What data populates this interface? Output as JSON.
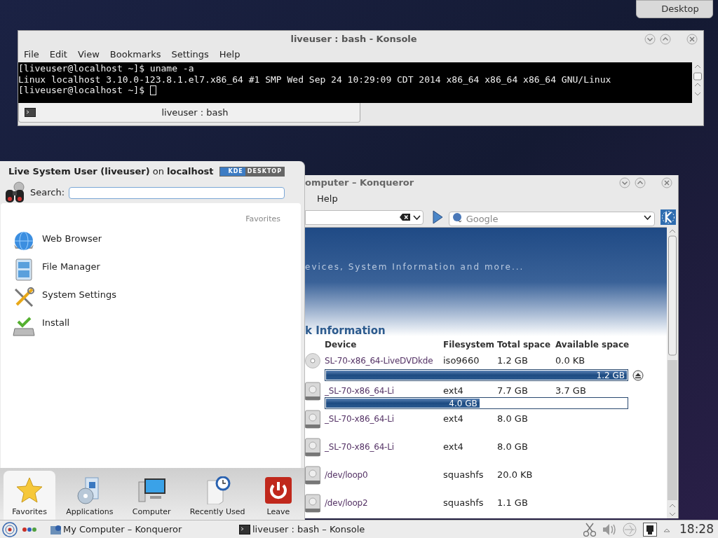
{
  "desktop_button": {
    "label": "Desktop"
  },
  "konsole": {
    "title": "liveuser : bash - Konsole",
    "menu": [
      "File",
      "Edit",
      "View",
      "Bookmarks",
      "Settings",
      "Help"
    ],
    "lines": [
      "[liveuser@localhost ~]$ uname -a",
      "Linux localhost 3.10.0-123.8.1.el7.x86_64 #1 SMP Wed Sep 24 10:29:09 CDT 2014 x86_64 x86_64 x86_64 GNU/Linux",
      "[liveuser@localhost ~]$ "
    ],
    "tabs": [
      {
        "label": "liveuser : bash",
        "selected": true
      }
    ]
  },
  "konqueror": {
    "title": "omputer – Konqueror",
    "menu": [
      "Help"
    ],
    "search": {
      "placeholder": "Google"
    },
    "banner": "evices, System Information and more...",
    "heading": "k Information",
    "columns": [
      "Device",
      "Filesystem",
      "Total space",
      "Available space"
    ],
    "rows": [
      {
        "kind": "optical",
        "device": "SL-70-x86_64-LiveDVDkde",
        "filesystem": "iso9660",
        "total": "1.2 GB",
        "available": "0.0 KB",
        "usage": {
          "level": 1,
          "label": "1.2 GB"
        }
      },
      {
        "kind": "disk",
        "device": "_SL-70-x86_64-Li",
        "filesystem": "ext4",
        "total": "7.7 GB",
        "available": "3.7 GB",
        "usage": {
          "level": 0.51,
          "label": "4.0 GB"
        }
      },
      {
        "kind": "disk",
        "device": "_SL-70-x86_64-Li",
        "filesystem": "ext4",
        "total": "8.0 GB"
      },
      {
        "kind": "disk",
        "device": "_SL-70-x86_64-Li",
        "filesystem": "ext4",
        "total": "8.0 GB"
      },
      {
        "kind": "disk",
        "device": "/dev/loop0",
        "filesystem": "squashfs",
        "total": "20.0 KB"
      },
      {
        "kind": "disk",
        "device": "/dev/loop2",
        "filesystem": "squashfs",
        "total": "1.1 GB"
      }
    ]
  },
  "launcher": {
    "user": "**Live System User (liveuser)** on **localhost**",
    "badge": [
      "KDE",
      "DESKTOP"
    ],
    "search_label": "Search:",
    "section": "Favorites",
    "favorites": [
      {
        "kind": "globe",
        "label": "Web Browser"
      },
      {
        "kind": "files",
        "label": "File Manager"
      },
      {
        "kind": "tools",
        "label": "System Settings"
      },
      {
        "kind": "install",
        "label": "Install"
      }
    ],
    "tabs": [
      {
        "kind": "star",
        "label": "Favorites",
        "selected": true
      },
      {
        "kind": "apps",
        "label": "Applications",
        "selected": false
      },
      {
        "kind": "computer",
        "label": "Computer",
        "selected": false
      },
      {
        "kind": "recent",
        "label": "Recently Used",
        "selected": false
      },
      {
        "kind": "leave",
        "label": "Leave",
        "selected": false
      }
    ]
  },
  "taskbar": {
    "tasks": [
      {
        "kind": "konqueror",
        "label": "My Computer – Konqueror"
      },
      {
        "kind": "terminal",
        "label": "liveuser : bash – Konsole"
      }
    ],
    "clock": "18:28"
  }
}
